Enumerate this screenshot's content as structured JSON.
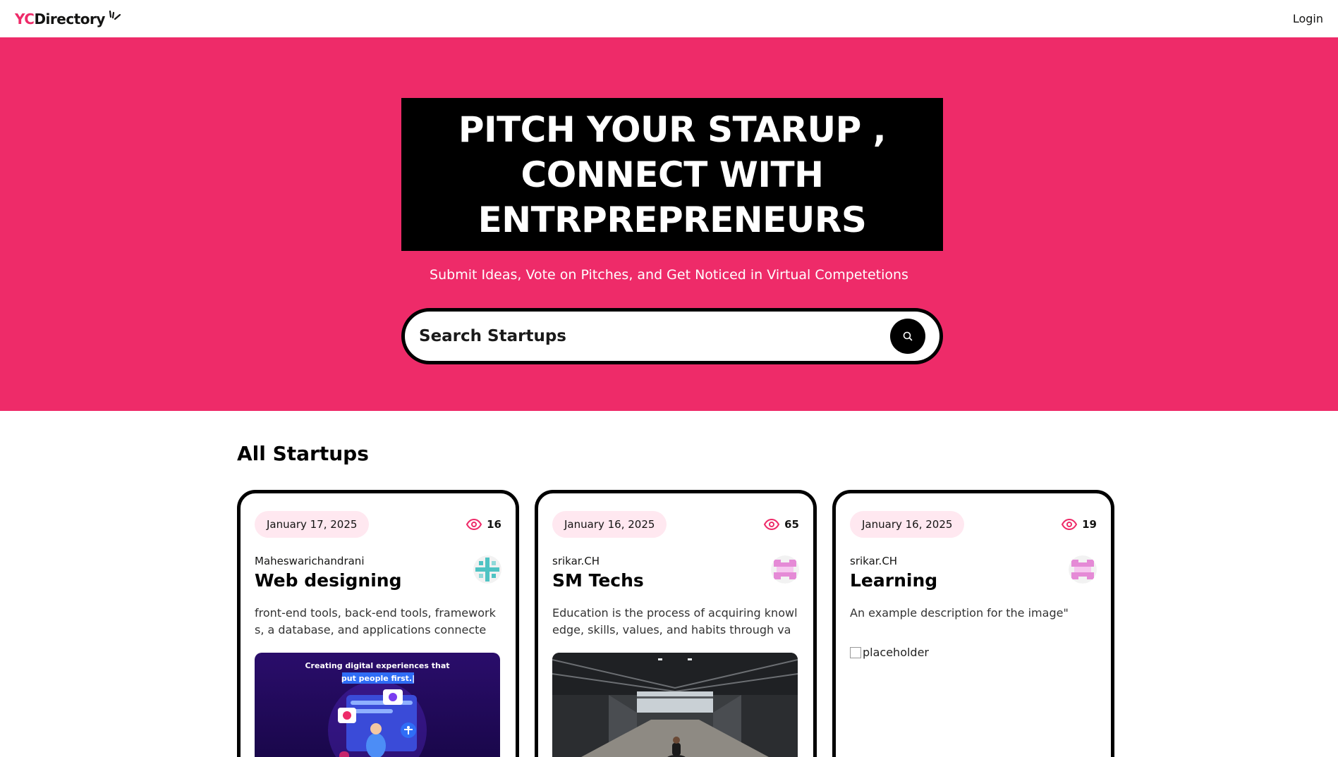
{
  "nav": {
    "logo_yc": "YC",
    "logo_directory": "Directory",
    "login_label": "Login"
  },
  "hero": {
    "heading": "PITCH YOUR STARUP , CONNECT WITH ENTRPREPRENEURS",
    "subheading": "Submit Ideas, Vote on Pitches, and Get Noticed in Virtual Competetions",
    "search_placeholder": "Search Startups"
  },
  "section": {
    "title": "All Startups"
  },
  "cards": [
    {
      "date": "January 17, 2025",
      "views": "16",
      "author": "Maheswarichandrani",
      "title": "Web designing",
      "description": "front-end tools, back-end tools, frameworks, a database, and applications connected…",
      "image_caption_line1": "Creating digital experiences that",
      "image_caption_line2": "put people first.|",
      "avatar_color": "#4fc3c3"
    },
    {
      "date": "January 16, 2025",
      "views": "65",
      "author": "srikar.CH",
      "title": "SM Techs",
      "description": "Education is the process of acquiring knowledge, skills, values, and habits through var…",
      "avatar_color": "#e58ad6"
    },
    {
      "date": "January 16, 2025",
      "views": "19",
      "author": "srikar.CH",
      "title": "Learning",
      "description": "An example description for the image\"",
      "image_alt": "placeholder",
      "avatar_color": "#e58ad6"
    }
  ],
  "colors": {
    "brand_pink": "#ee2b69",
    "badge_pink": "#ffe8f0",
    "black": "#000000"
  }
}
